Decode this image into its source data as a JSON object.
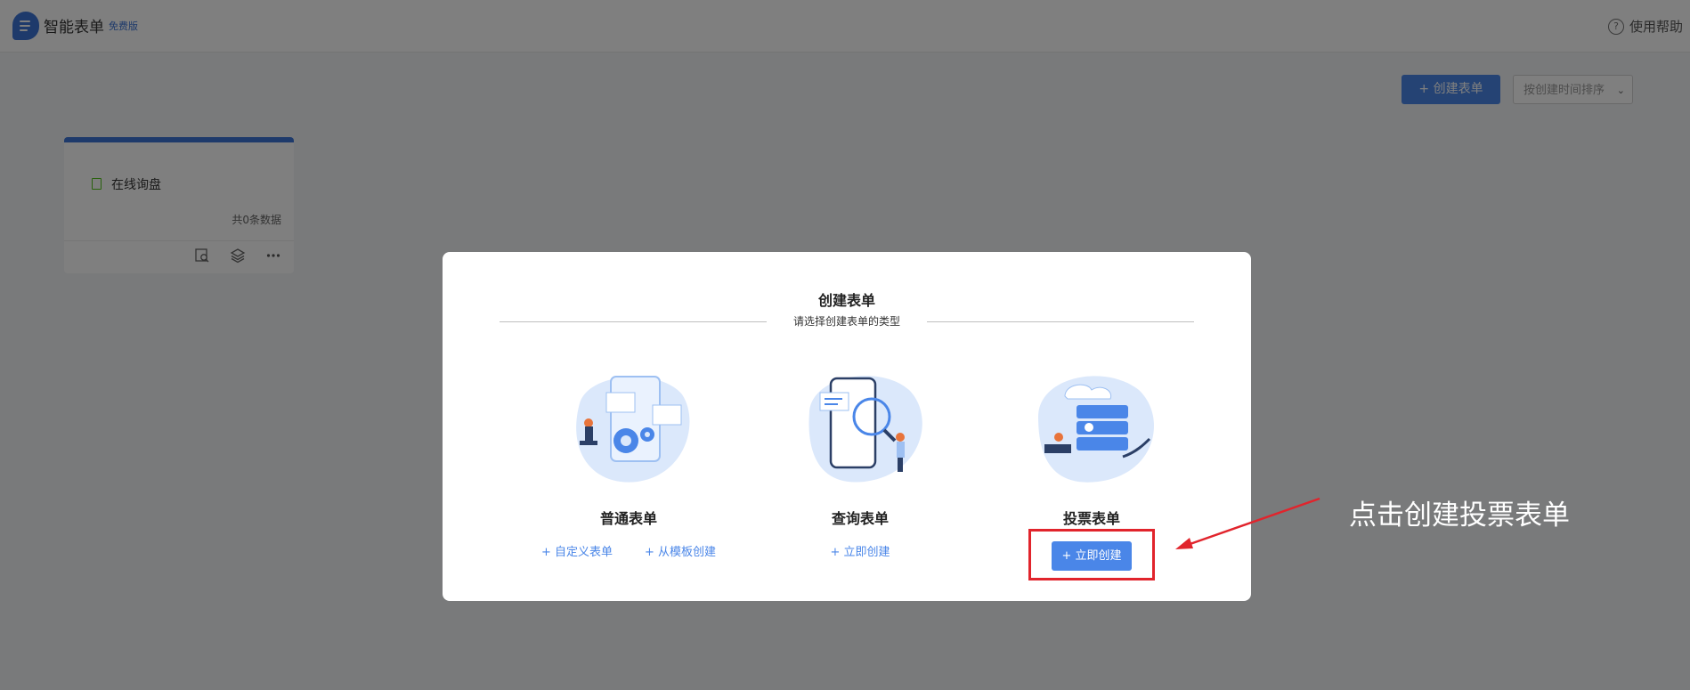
{
  "header": {
    "app_title": "智能表单",
    "plan_badge": "免费版",
    "help_label": "使用帮助",
    "help_icon": "question-circle-icon"
  },
  "toolbar": {
    "create_label": "+ 创建表单",
    "sort_value": "按创建时间排序"
  },
  "form_card": {
    "title": "在线询盘",
    "count": "共0条数据",
    "actions": [
      "search-doc-icon",
      "layers-icon",
      "more-icon"
    ]
  },
  "modal": {
    "title": "创建表单",
    "subtitle": "请选择创建表单的类型",
    "options": [
      {
        "name": "普通表单",
        "links": [
          "+ 自定义表单",
          "+ 从模板创建"
        ]
      },
      {
        "name": "查询表单",
        "links": [
          "+ 立即创建"
        ]
      },
      {
        "name": "投票表单",
        "button": "+ 立即创建"
      }
    ]
  },
  "annotation": {
    "text": "点击创建投票表单"
  },
  "colors": {
    "accent": "#4a86e8",
    "brand": "#3c74d6",
    "highlight": "#e1242c",
    "mask": "rgba(0,0,0,0.5)"
  }
}
